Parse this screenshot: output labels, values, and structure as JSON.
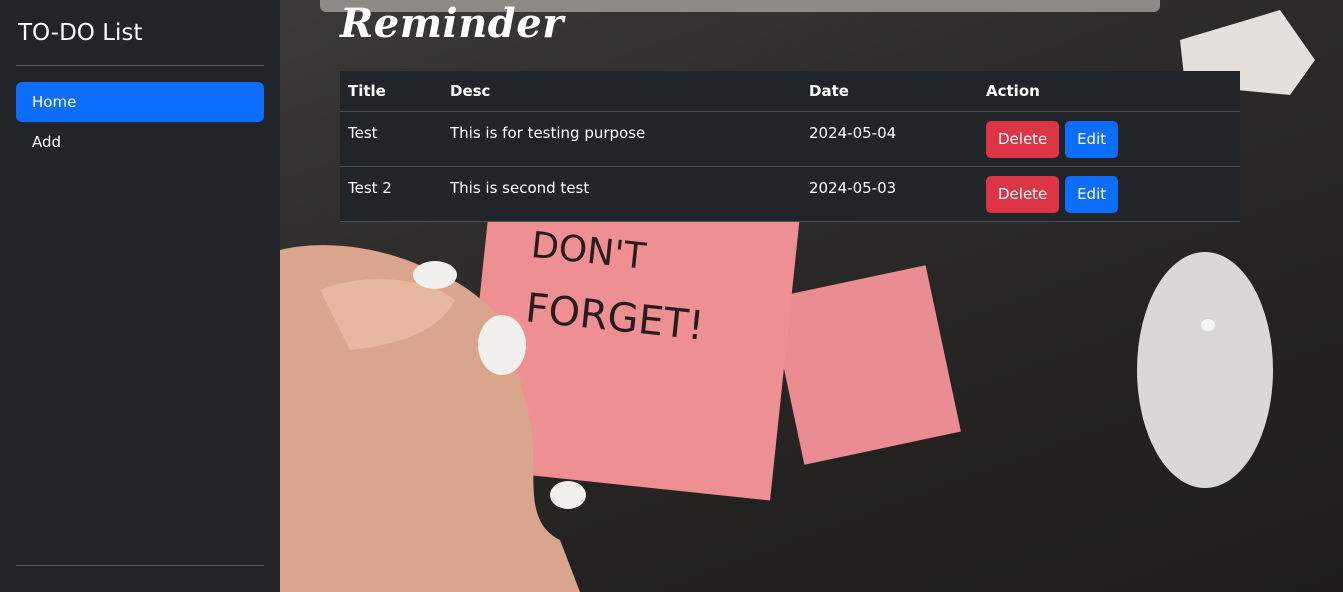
{
  "sidebar": {
    "brand": "TO-DO List",
    "items": [
      {
        "label": "Home",
        "active": true
      },
      {
        "label": "Add",
        "active": false
      }
    ]
  },
  "main": {
    "title": "Reminder",
    "note_text": [
      "DON'T",
      "FORGET!"
    ],
    "table": {
      "headers": [
        "Title",
        "Desc",
        "Date",
        "Action"
      ],
      "rows": [
        {
          "title": "Test",
          "desc": "This is for testing purpose",
          "date": "2024-05-04"
        },
        {
          "title": "Test 2",
          "desc": "This is second test",
          "date": "2024-05-03"
        }
      ],
      "delete_label": "Delete",
      "edit_label": "Edit"
    }
  },
  "colors": {
    "sidebar_bg": "#212529",
    "active_nav": "#0d6efd",
    "delete": "#dc3545",
    "edit": "#0d6efd"
  }
}
